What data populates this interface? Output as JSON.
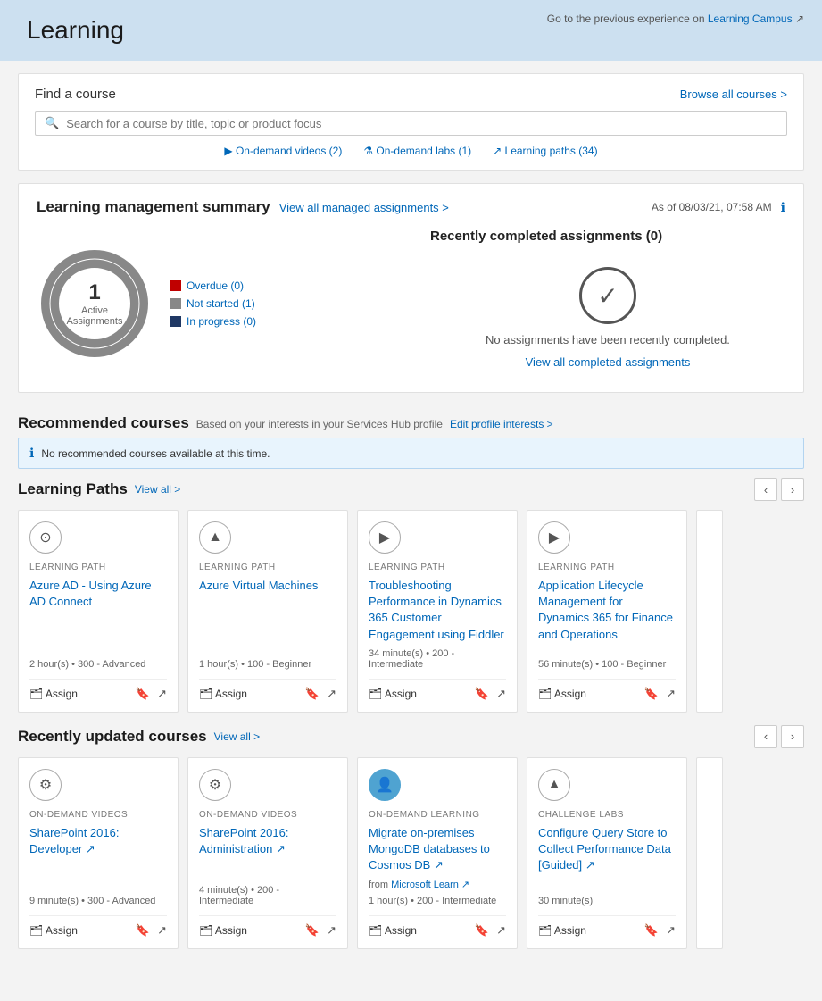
{
  "header": {
    "title": "Learning",
    "previous_experience_text": "Go to the previous experience on",
    "learning_campus_label": "Learning Campus",
    "learning_campus_link": "#"
  },
  "search": {
    "find_course_label": "Find a course",
    "browse_all_label": "Browse all courses >",
    "search_placeholder": "Search for a course by title, topic or product focus",
    "filters": [
      {
        "icon": "▶",
        "label": "On-demand videos (2)"
      },
      {
        "icon": "⚗",
        "label": "On-demand labs (1)"
      },
      {
        "icon": "↗",
        "label": "Learning paths (34)"
      }
    ]
  },
  "lms": {
    "title": "Learning management summary",
    "view_link": "View all managed assignments >",
    "as_of": "As of 08/03/21, 07:58 AM",
    "donut": {
      "number": "1",
      "label": "Active Assignments",
      "segments": [
        {
          "color": "#c00000",
          "label": "Overdue (0)",
          "value": 0
        },
        {
          "color": "#888",
          "label": "Not started (1)",
          "value": 1
        },
        {
          "color": "#1f3864",
          "label": "In progress (0)",
          "value": 0
        }
      ]
    },
    "completed": {
      "title": "Recently completed assignments (0)",
      "empty_text": "No assignments have been recently completed.",
      "view_all_link": "View all completed assignments"
    }
  },
  "recommended": {
    "title": "Recommended courses",
    "subtitle": "Based on your interests in your Services Hub profile",
    "edit_link": "Edit profile interests >",
    "no_courses_message": "No recommended courses available at this time."
  },
  "learning_paths": {
    "title": "Learning Paths",
    "view_all": "View all >",
    "cards": [
      {
        "type": "LEARNING PATH",
        "icon": "⊙",
        "title": "Azure AD - Using Azure AD Connect",
        "meta": "2 hour(s)  •  300 - Advanced"
      },
      {
        "type": "LEARNING PATH",
        "icon": "▲",
        "title": "Azure Virtual Machines",
        "meta": "1 hour(s)  •  100 - Beginner"
      },
      {
        "type": "LEARNING PATH",
        "icon": "▶",
        "title": "Troubleshooting Performance in Dynamics 365 Customer Engagement using Fiddler",
        "meta": "34 minute(s)  •  200 - Intermediate"
      },
      {
        "type": "LEARNING PATH",
        "icon": "▶",
        "title": "Application Lifecycle Management for Dynamics 365 for Finance and Operations",
        "meta": "56 minute(s)  •  100 - Beginner"
      }
    ],
    "assign_label": "Assign"
  },
  "recently_updated": {
    "title": "Recently updated courses",
    "view_all": "View all >",
    "cards": [
      {
        "type": "ON-DEMAND VIDEOS",
        "icon": "⚙",
        "title": "SharePoint 2016: Developer ↗",
        "meta": "9 minute(s)  •  300 - Advanced",
        "from": null
      },
      {
        "type": "ON-DEMAND VIDEOS",
        "icon": "⚙",
        "title": "SharePoint 2016: Administration ↗",
        "meta": "4 minute(s)  •  200 - Intermediate",
        "from": null
      },
      {
        "type": "ON-DEMAND LEARNING",
        "icon": "👤",
        "title": "Migrate on-premises MongoDB databases to Cosmos DB ↗",
        "meta": "1 hour(s)  •  200 - Intermediate",
        "from": "Microsoft Learn ↗"
      },
      {
        "type": "CHALLENGE LABS",
        "icon": "▲",
        "title": "Configure Query Store to Collect Performance Data [Guided] ↗",
        "meta": "30 minute(s)",
        "from": null
      }
    ],
    "assign_label": "Assign"
  }
}
